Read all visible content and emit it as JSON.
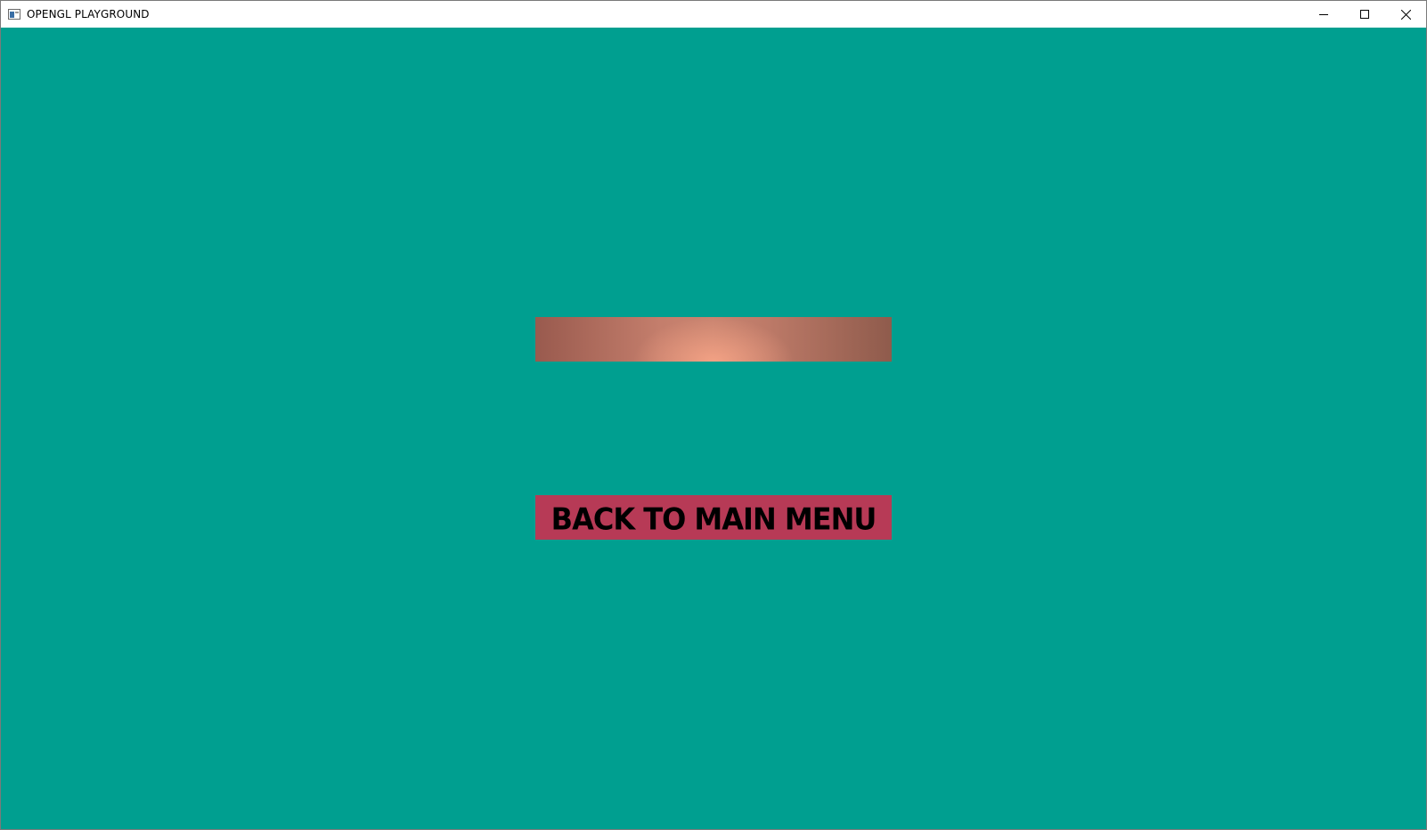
{
  "window": {
    "title": "OPENGL PLAYGROUND",
    "controls": {
      "minimize": "minimize-icon",
      "maximize": "maximize-icon",
      "close": "close-icon"
    }
  },
  "scene": {
    "background_color": "#009f90",
    "top_panel_color": "#c47e6c",
    "back_button": {
      "label": "BACK TO MAIN MENU",
      "color": "#b73a56"
    }
  }
}
